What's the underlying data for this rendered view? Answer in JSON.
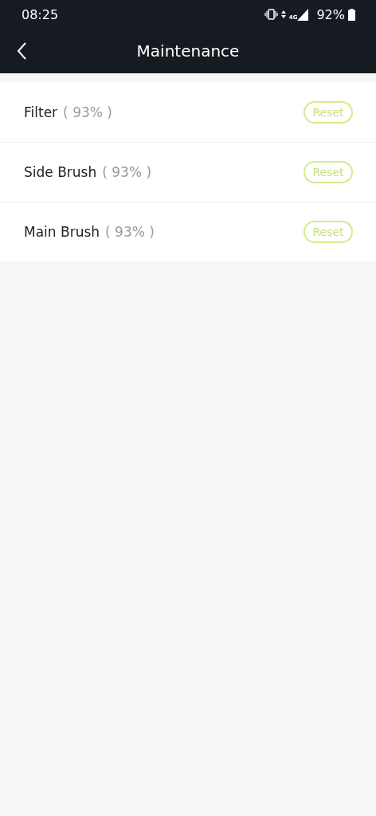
{
  "status_bar": {
    "time": "08:25",
    "network": "4G",
    "battery": "92%"
  },
  "header": {
    "title": "Maintenance"
  },
  "items": [
    {
      "name": "Filter",
      "percent": "( 93% )",
      "action": "Reset"
    },
    {
      "name": "Side Brush",
      "percent": "( 93% )",
      "action": "Reset"
    },
    {
      "name": "Main Brush",
      "percent": "( 93% )",
      "action": "Reset"
    }
  ]
}
